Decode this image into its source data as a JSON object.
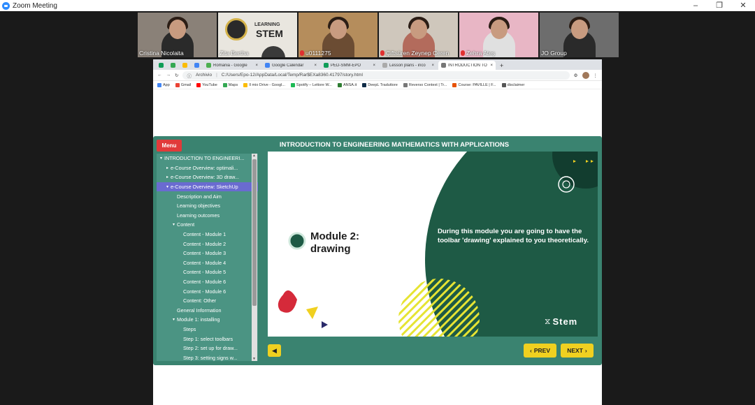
{
  "zoom": {
    "title": "Zoom Meeting"
  },
  "participants": [
    {
      "name": "Cristina Nicolaita",
      "muted": false,
      "bg": "#8a8178",
      "shirt": "#2a2a2a"
    },
    {
      "name": "Zita Bertha",
      "muted": false,
      "bg": "#e9e6df",
      "shirt": "#3a3a3a"
    },
    {
      "name": "u0111275",
      "muted": true,
      "bg": "#b58d5c",
      "shirt": "#6b4c33"
    },
    {
      "name": "Çiftsüren Zeynep Ceren",
      "muted": true,
      "bg": "#cfc7bc",
      "shirt": "#b36b5c"
    },
    {
      "name": "Zehra Ateş",
      "muted": true,
      "bg": "#e8b6c5",
      "shirt": "#e0e0e0"
    },
    {
      "name": "JO Group",
      "muted": false,
      "bg": "#6d6d6d",
      "shirt": "#2a2a2a"
    }
  ],
  "tile2_logo_text": "STEM",
  "tile2_logo_sub": "LEARNING",
  "browser": {
    "tabs": [
      {
        "label": "Romania - Google",
        "color": "#4caf50"
      },
      {
        "label": "Google Calendar",
        "color": "#4285f4"
      },
      {
        "label": "PED-SMM-EPO",
        "color": "#0f9d58"
      },
      {
        "label": "Lesson plans - inco",
        "color": "#aaaaaa"
      },
      {
        "label": "INTRODUCTION TO",
        "color": "#777777",
        "active": true
      }
    ],
    "url_prefix": "Archivio",
    "url": "C:/Users/Epo-12/AppData/Local/Temp/Rar$EXa8360.41797/story.html",
    "bookmarks": [
      {
        "label": "App",
        "color": "#4285f4"
      },
      {
        "label": "Gmail",
        "color": "#ea4335"
      },
      {
        "label": "YouTube",
        "color": "#ff0000"
      },
      {
        "label": "Maps",
        "color": "#34a853"
      },
      {
        "label": "Il mio Drive - Googl...",
        "color": "#fbbc04"
      },
      {
        "label": "Spotify – Lettore W...",
        "color": "#1db954"
      },
      {
        "label": "ANSA.it",
        "color": "#2e7d32"
      },
      {
        "label": "DeepL Traduttore",
        "color": "#0f2b46"
      },
      {
        "label": "Reverso Context | Tr...",
        "color": "#777777"
      },
      {
        "label": "Course: PAVILLE | F...",
        "color": "#e65100"
      },
      {
        "label": "disclaimer",
        "color": "#555555"
      }
    ]
  },
  "player": {
    "menu_label": "Menu",
    "course_title": "INTRODUCTION TO ENGINEERING MATHEMATICS WITH APPLICATIONS",
    "menu_items": [
      {
        "label": "INTRODUCTION TO ENGINEERI...",
        "indent": 0,
        "arrow": "▾"
      },
      {
        "label": "e-Course Overview: optimali...",
        "indent": 1,
        "arrow": "▸"
      },
      {
        "label": "e-Course Overview: 3D draw...",
        "indent": 1,
        "arrow": "▸"
      },
      {
        "label": "e-Course Overview: SketchUp",
        "indent": 1,
        "arrow": "▾",
        "selected": true
      },
      {
        "label": "Description and Aim",
        "indent": 2,
        "arrow": ""
      },
      {
        "label": "Learning objectives",
        "indent": 2,
        "arrow": ""
      },
      {
        "label": "Learning outcomes",
        "indent": 2,
        "arrow": ""
      },
      {
        "label": "Content",
        "indent": 2,
        "arrow": "▾"
      },
      {
        "label": "Content - Module 1",
        "indent": 3,
        "arrow": ""
      },
      {
        "label": "Content - Module 2",
        "indent": 3,
        "arrow": ""
      },
      {
        "label": "Content - Module 3",
        "indent": 3,
        "arrow": ""
      },
      {
        "label": "Content - Module 4",
        "indent": 3,
        "arrow": ""
      },
      {
        "label": "Content - Module 5",
        "indent": 3,
        "arrow": ""
      },
      {
        "label": "Content - Module 6",
        "indent": 3,
        "arrow": ""
      },
      {
        "label": "Content - Module 6",
        "indent": 3,
        "arrow": ""
      },
      {
        "label": "Content: Other",
        "indent": 3,
        "arrow": ""
      },
      {
        "label": "General Information",
        "indent": 2,
        "arrow": ""
      },
      {
        "label": "Module 1: installing",
        "indent": 2,
        "arrow": "▾"
      },
      {
        "label": "Steps",
        "indent": 3,
        "arrow": ""
      },
      {
        "label": "Step 1: select toolbars",
        "indent": 3,
        "arrow": ""
      },
      {
        "label": "Step 2: set up for draw...",
        "indent": 3,
        "arrow": ""
      },
      {
        "label": "Step 3: setting signs w...",
        "indent": 3,
        "arrow": ""
      }
    ],
    "slide": {
      "module_title_line1": "Module 2:",
      "module_title_line2": "drawing",
      "description": "During this module you are going to have the toolbar 'drawing' explained to you theoretically.",
      "brand": "Stem"
    },
    "prev_label": "PREV",
    "next_label": "NEXT"
  }
}
